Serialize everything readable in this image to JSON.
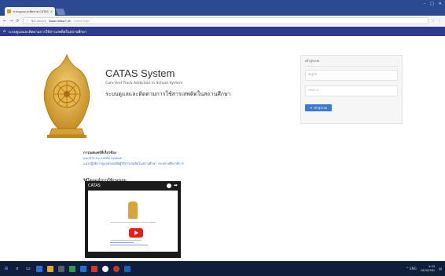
{
  "browser": {
    "tab_title": "ระบบดูแลและติดตาม-CATAS",
    "tab_close": "×",
    "win_controls": [
      "–",
      "□",
      "✕"
    ],
    "url_security": "Not secure",
    "url_host": "www.catas.in.th",
    "url_path": "/catas/login"
  },
  "site_nav": {
    "title": "ระบบดูแลและติดตามการใช้สารเสพติดในสถานศึกษา"
  },
  "brand": {
    "title": "CATAS System",
    "subtitle": "Care And Track Addiction in School System",
    "thai_title": "ระบบดูแลและติดตามการใช้สารเสพติดในสถานศึกษา"
  },
  "login": {
    "heading": "เข้าสู่ระบบ",
    "username_placeholder": "ชื่อผู้ใช้",
    "password_placeholder": "รหัสผ่าน",
    "button_label": "เข้าสู่ระบบ"
  },
  "related": {
    "title": "การเผยแพร่ที่เกี่ยวข้อง",
    "links": [
      "แนะนำระบบ CATAS System",
      "แนวปฏิบัติการดูแลช่วยเหลือผู้ใช้สารเสพติดในสถานศึกษา กระทรวงศึกษาธิการ"
    ]
  },
  "video": {
    "section_title": "วิดีโอแนะนำการใช้งานระบบ",
    "player_title": "CATAS"
  },
  "taskbar": {
    "tray": "^ ENG",
    "time": "9:53",
    "date": "16/3/2561"
  }
}
